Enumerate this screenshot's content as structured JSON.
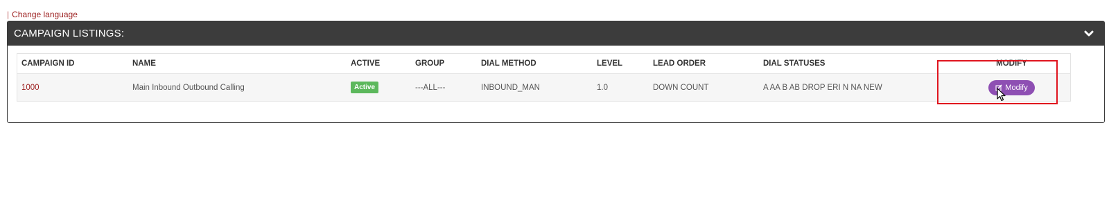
{
  "topbar": {
    "separator": "|",
    "change_language": "Change language"
  },
  "panel": {
    "title": "CAMPAIGN LISTINGS:",
    "collapse_icon": "chevron-down-icon"
  },
  "table": {
    "columns": [
      "CAMPAIGN ID",
      "NAME",
      "ACTIVE",
      "GROUP",
      "DIAL METHOD",
      "LEVEL",
      "LEAD ORDER",
      "DIAL STATUSES",
      "MODIFY"
    ],
    "rows": [
      {
        "campaign_id": "1000",
        "name": "Main Inbound Outbound Calling",
        "active": "Active",
        "group": "---ALL---",
        "dial_method": "INBOUND_MAN",
        "level": "1.0",
        "lead_order": "DOWN COUNT",
        "dial_statuses": "A AA B AB DROP ERI N NA NEW",
        "modify_label": "Modify",
        "modify_icon": "edit-icon"
      }
    ]
  },
  "colors": {
    "header_bg": "#3c3c3c",
    "active_badge": "#5cb85c",
    "modify_button": "#8e4fb3",
    "link": "#9b1c1c",
    "highlight": "#e0141e"
  }
}
